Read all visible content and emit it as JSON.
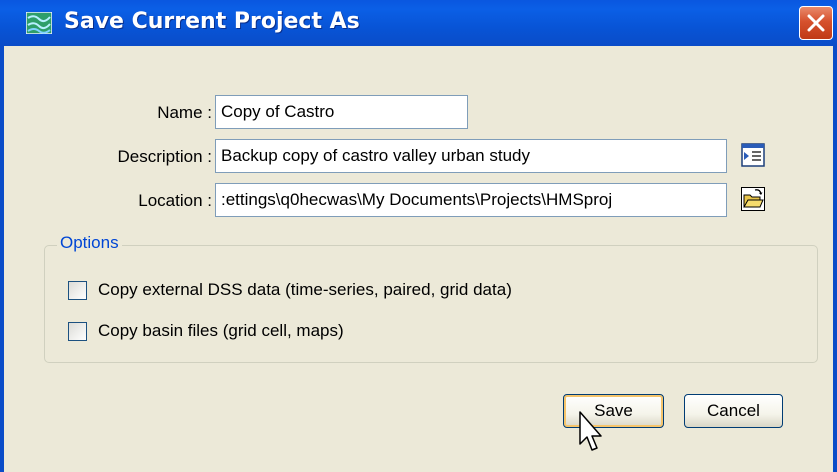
{
  "window": {
    "title": "Save Current Project As"
  },
  "form": {
    "name_label": "Name :",
    "name_value": "Copy of Castro",
    "description_label": "Description :",
    "description_value": "Backup copy of castro valley urban study",
    "location_label": "Location :",
    "location_value": ":ettings\\q0hecwas\\My Documents\\Projects\\HMSproj"
  },
  "options": {
    "legend": "Options",
    "items": [
      {
        "label": "Copy external DSS data (time-series, paired, grid data)",
        "checked": false
      },
      {
        "label": "Copy basin files (grid cell, maps)",
        "checked": false
      }
    ]
  },
  "buttons": {
    "save": "Save",
    "cancel": "Cancel"
  },
  "icons": {
    "app": "watershed-app-icon",
    "close": "close-icon",
    "description_editor": "text-editor-icon",
    "browse": "open-folder-icon",
    "cursor": "mouse-pointer-icon"
  },
  "colors": {
    "titlebar": "#0a54d6",
    "dialog_bg": "#ece9d8",
    "legend_text": "#0046d5",
    "close_button": "#d6512d"
  }
}
